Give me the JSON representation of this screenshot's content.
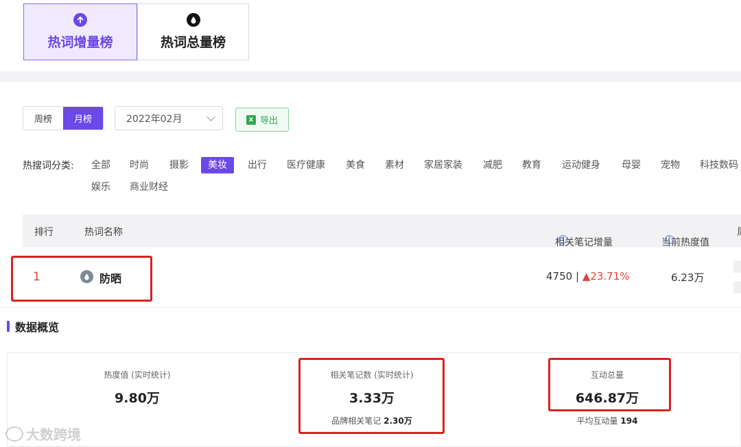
{
  "tabs": [
    {
      "label": "热词增量榜",
      "icon": "arrow-up-circle-icon",
      "active": true
    },
    {
      "label": "热词总量榜",
      "icon": "drop-icon",
      "active": false
    }
  ],
  "period": {
    "weekly": "周榜",
    "monthly": "月榜",
    "selected": "月榜"
  },
  "month_select": {
    "value": "2022年02月"
  },
  "export_label": "导出",
  "category": {
    "label": "热搜词分类:",
    "items": [
      "全部",
      "时尚",
      "摄影",
      "美妆",
      "出行",
      "医疗健康",
      "美食",
      "素材",
      "家居家装",
      "减肥",
      "教育",
      "运动健身",
      "母婴",
      "宠物",
      "科技数码",
      "娱乐",
      "商业财经"
    ],
    "selected": "美妆"
  },
  "table": {
    "headers": {
      "rank": "排行",
      "name": "热词名称",
      "increase": "相关笔记增量",
      "heat": "当前热度值",
      "extra": "周"
    },
    "rows": [
      {
        "rank": "1",
        "word": "防晒",
        "increase": "4750 |",
        "pct": "▲23.71%",
        "heat": "6.23万"
      }
    ]
  },
  "overview": {
    "title": "数据概览",
    "stats": [
      {
        "label": "热度值 (实时统计)",
        "value": "9.80万",
        "sub_label": "",
        "sub_value": ""
      },
      {
        "label": "相关笔记数 (实时统计)",
        "value": "3.33万",
        "sub_label": "品牌相关笔记",
        "sub_value": "2.30万"
      },
      {
        "label": "互动总量",
        "value": "646.87万",
        "sub_label": "平均互动量",
        "sub_value": "194"
      }
    ]
  },
  "watermark": "大数跨境",
  "colors": {
    "accent": "#6b48e8",
    "highlight_box": "#d6231f",
    "up": "#e0413a"
  }
}
